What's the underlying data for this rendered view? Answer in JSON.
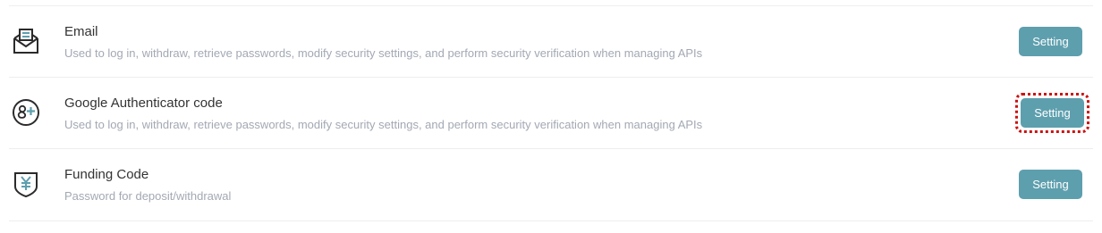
{
  "security": {
    "items": [
      {
        "title": "Email",
        "description": "Used to log in, withdraw, retrieve passwords, modify security settings, and perform security verification when managing APIs",
        "button_label": "Setting",
        "icon": "email-icon"
      },
      {
        "title": "Google Authenticator code",
        "description": "Used to log in, withdraw, retrieve passwords, modify security settings, and perform security verification when managing APIs",
        "button_label": "Setting",
        "icon": "google-authenticator-icon",
        "highlighted": true
      },
      {
        "title": "Funding Code",
        "description": "Password for deposit/withdrawal",
        "button_label": "Setting",
        "icon": "funding-shield-icon"
      }
    ]
  },
  "colors": {
    "button_bg": "#5e9fae",
    "highlight_outline": "#cc1111",
    "icon_accent": "#5e9fae",
    "icon_stroke": "#2b2b2b"
  }
}
